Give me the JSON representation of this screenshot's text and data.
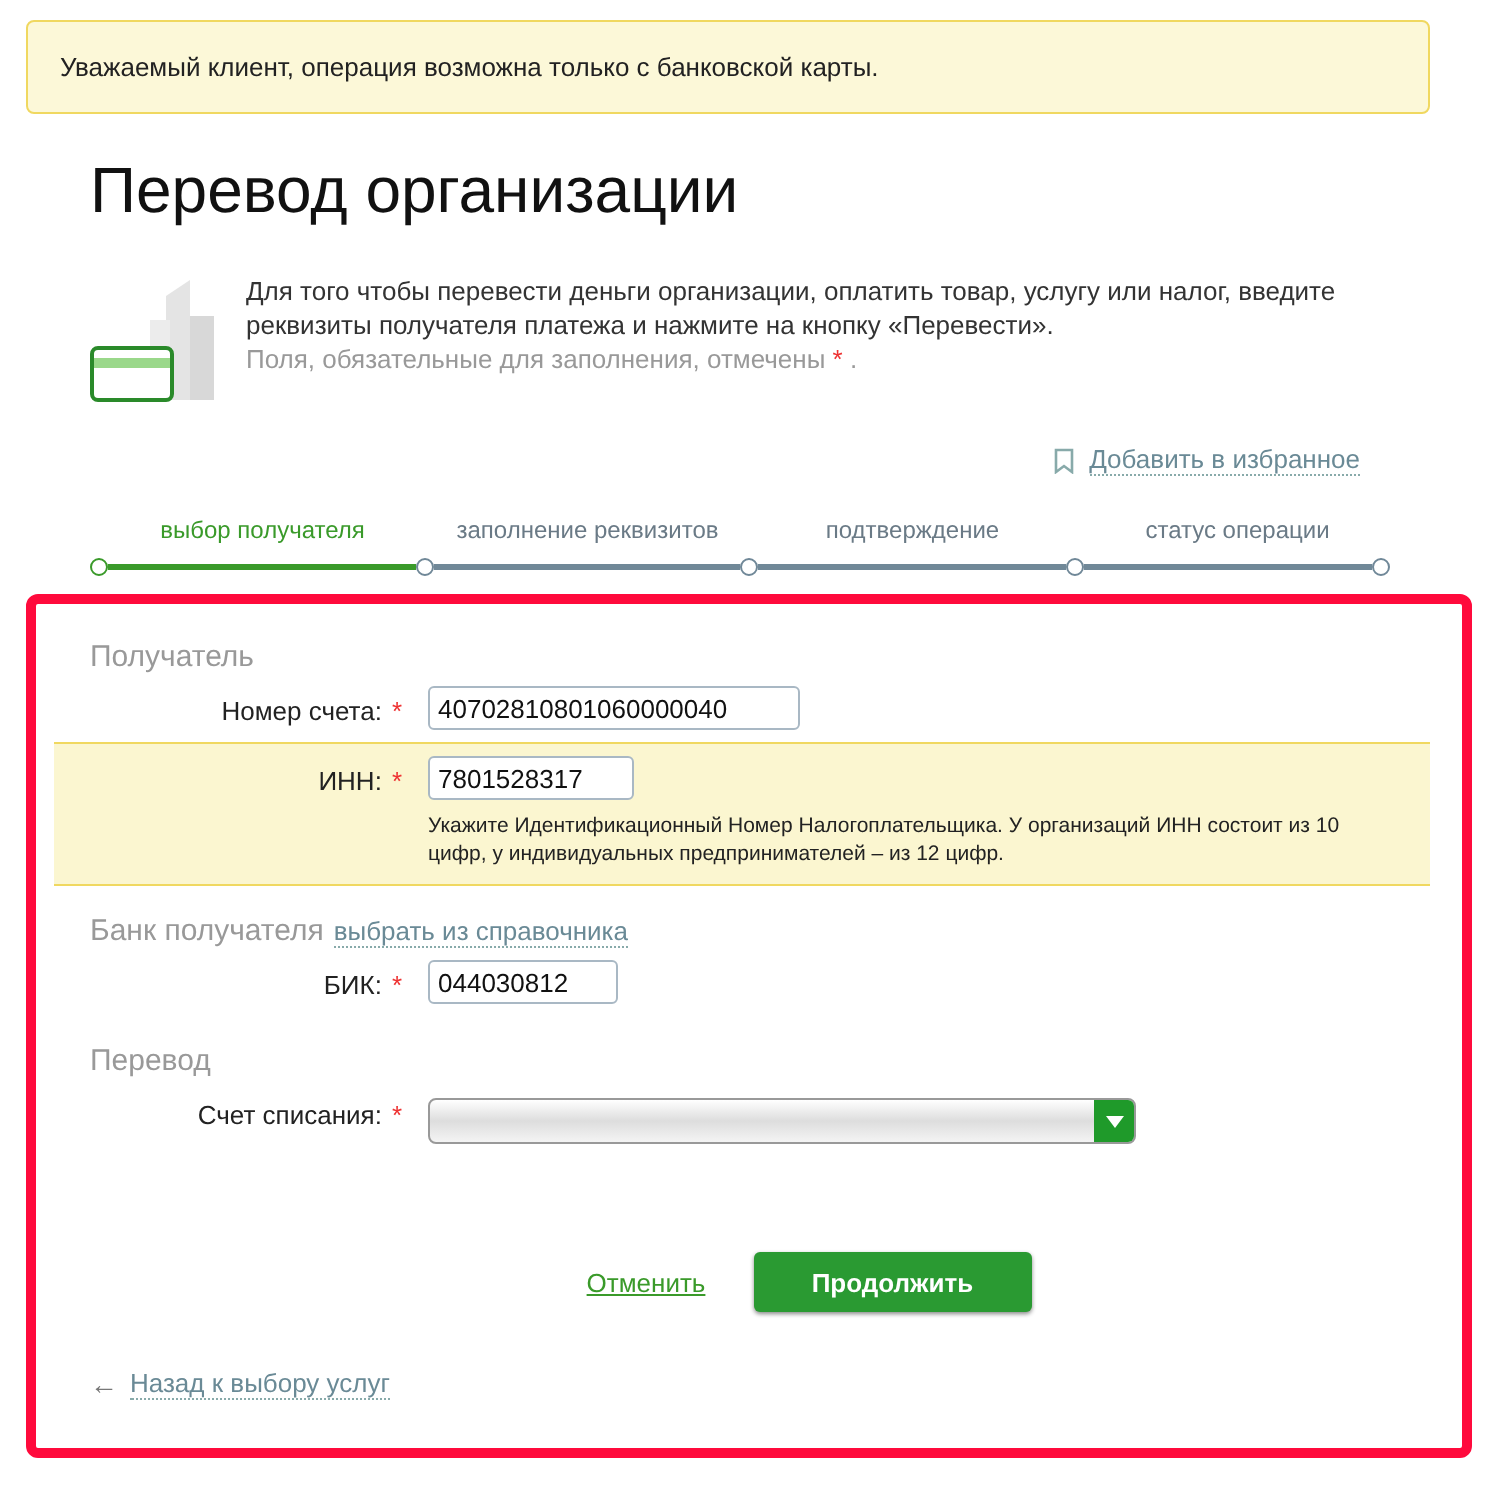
{
  "notice": "Уважаемый клиент, операция возможна только с банковской карты.",
  "title": "Перевод организации",
  "intro": {
    "text": "Для того чтобы перевести деньги организации, оплатить товар, услугу или налог, введите реквизиты получателя платежа и нажмите на кнопку «Перевести».",
    "required_note": "Поля, обязательные для заполнения, отмечены",
    "required_mark": "*",
    "required_end": "."
  },
  "favorite_link": "Добавить в избранное",
  "steps": [
    {
      "label": "выбор получателя",
      "selected": true
    },
    {
      "label": "заполнение реквизитов",
      "selected": false
    },
    {
      "label": "подтверждение",
      "selected": false
    },
    {
      "label": "статус операции",
      "selected": false
    }
  ],
  "sections": [
    {
      "title": "Получатель",
      "fields": [
        {
          "kind": "input",
          "label": "Номер счета:",
          "required": true,
          "value": "40702810801060000040",
          "highlighted": false
        },
        {
          "kind": "input",
          "label": "ИНН:",
          "required": true,
          "value": "7801528317",
          "highlighted": true,
          "hint": "Укажите Идентификационный Номер Налогоплательщика. У организаций ИНН состоит из 10 цифр, у индивидуальных предпринимателей – из 12 цифр."
        }
      ]
    },
    {
      "title": "Банк получателя",
      "link": "выбрать из справочника",
      "fields": [
        {
          "kind": "input",
          "label": "БИК:",
          "required": true,
          "value": "044030812",
          "highlighted": false
        }
      ]
    },
    {
      "title": "Перевод",
      "fields": [
        {
          "kind": "select",
          "label": "Счет списания:",
          "required": true,
          "highlighted": false
        }
      ]
    }
  ],
  "actions": {
    "cancel": "Отменить",
    "continue": "Продолжить"
  },
  "back_link": "Назад к выбору услуг",
  "back_arrow": "←"
}
